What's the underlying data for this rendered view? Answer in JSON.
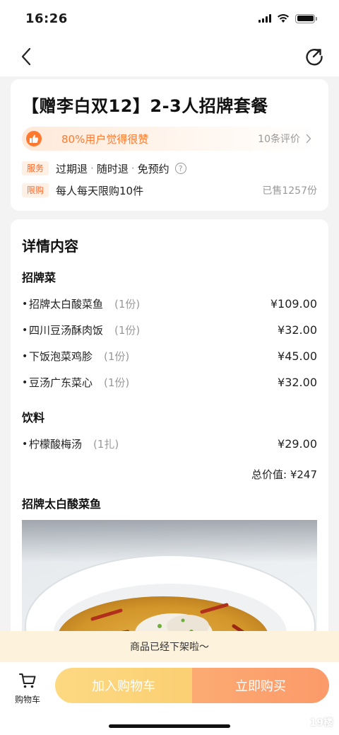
{
  "status_bar": {
    "time": "16:26"
  },
  "deal": {
    "title": "【赠李白双12】2-3人招牌套餐",
    "praise_text": "80%用户觉得很赞",
    "review_count_text": "10条评价",
    "service_tag": "服务",
    "service_items": [
      "过期退",
      "随时退",
      "免预约"
    ],
    "limit_tag": "限购",
    "limit_text": "每人每天限购10件",
    "sold_text": "已售1257份"
  },
  "details": {
    "section_title": "详情内容",
    "groups": [
      {
        "title": "招牌菜",
        "items": [
          {
            "name": "招牌太白酸菜鱼",
            "qty": "(1份)",
            "price": "¥109.00"
          },
          {
            "name": "四川豆汤酥肉饭",
            "qty": "(1份)",
            "price": "¥32.00"
          },
          {
            "name": "下饭泡菜鸡胗",
            "qty": "(1份)",
            "price": "¥45.00"
          },
          {
            "name": "豆汤广东菜心",
            "qty": "(1份)",
            "price": "¥32.00"
          }
        ]
      },
      {
        "title": "饮料",
        "items": [
          {
            "name": "柠檬酸梅汤",
            "qty": "(1扎)",
            "price": "¥29.00"
          }
        ]
      }
    ],
    "total_text": "总价值: ¥247",
    "photo_title": "招牌太白酸菜鱼"
  },
  "notice": "商品已经下架啦～",
  "bottom_bar": {
    "cart_label": "购物车",
    "add_to_cart": "加入购物车",
    "buy_now": "立即购买"
  },
  "watermark": "19楼",
  "colors": {
    "accent_orange": "#ff7a2e",
    "tag_bg": "#fff0e6",
    "notice_bg": "#fdf3dc",
    "add_button": "#fbcf73",
    "buy_button": "#fb9a6a"
  }
}
